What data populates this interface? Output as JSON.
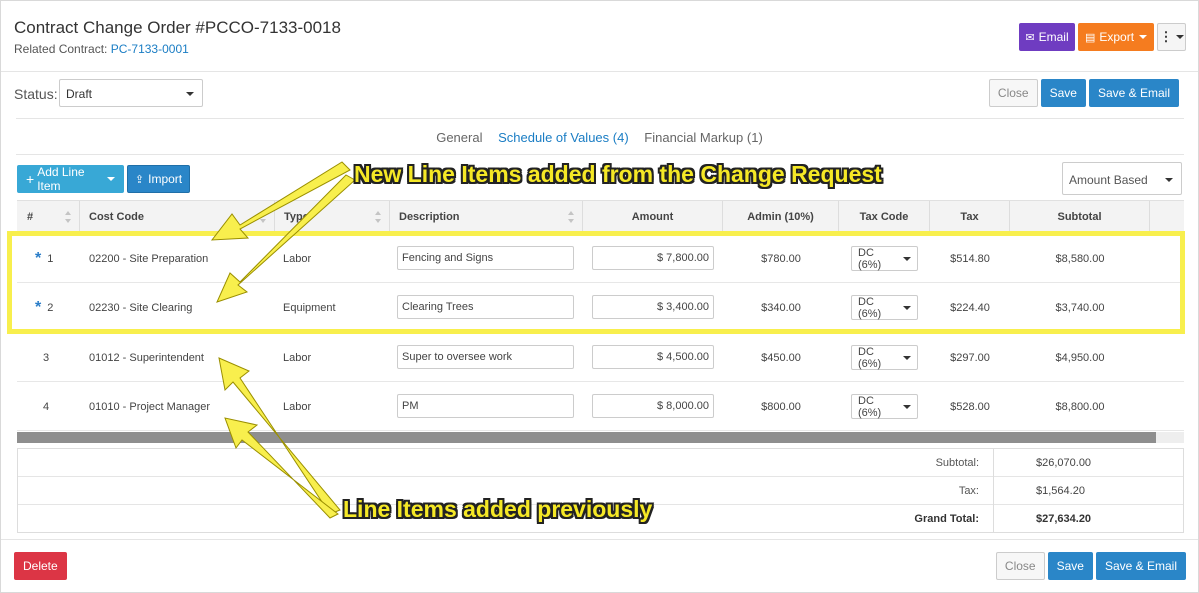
{
  "header": {
    "title": "Contract Change Order #PCCO-7133-0018",
    "related_label": "Related Contract:",
    "related_link": "PC-7133-0001",
    "email_label": "Email",
    "export_label": "Export"
  },
  "status": {
    "label": "Status:",
    "value": "Draft",
    "close_label": "Close",
    "save_label": "Save",
    "save_email_label": "Save & Email"
  },
  "tabs": [
    {
      "label": "General"
    },
    {
      "label": "Schedule of Values (4)"
    },
    {
      "label": "Financial Markup (1)"
    }
  ],
  "tools": {
    "add_label": "Add Line Item",
    "import_label": "Import",
    "amount_mode": "Amount Based"
  },
  "table": {
    "columns": [
      "#",
      "Cost Code",
      "Type",
      "Description",
      "Amount",
      "Admin (10%)",
      "Tax Code",
      "Tax",
      "Subtotal"
    ],
    "rows": [
      {
        "num": "1",
        "new": true,
        "cost_code": "02200 - Site Preparation",
        "type": "Labor",
        "description": "Fencing and Signs",
        "amount": "$ 7,800.00",
        "admin": "$780.00",
        "tax_code": "DC (6%)",
        "tax": "$514.80",
        "subtotal": "$8,580.00"
      },
      {
        "num": "2",
        "new": true,
        "cost_code": "02230 - Site Clearing",
        "type": "Equipment",
        "description": "Clearing Trees",
        "amount": "$ 3,400.00",
        "admin": "$340.00",
        "tax_code": "DC (6%)",
        "tax": "$224.40",
        "subtotal": "$3,740.00"
      },
      {
        "num": "3",
        "new": false,
        "cost_code": "01012 - Superintendent",
        "type": "Labor",
        "description": "Super to oversee work",
        "amount": "$ 4,500.00",
        "admin": "$450.00",
        "tax_code": "DC (6%)",
        "tax": "$297.00",
        "subtotal": "$4,950.00"
      },
      {
        "num": "4",
        "new": false,
        "cost_code": "01010 - Project Manager",
        "type": "Labor",
        "description": "PM",
        "amount": "$ 8,000.00",
        "admin": "$800.00",
        "tax_code": "DC (6%)",
        "tax": "$528.00",
        "subtotal": "$8,800.00"
      }
    ]
  },
  "totals": {
    "subtotal_label": "Subtotal:",
    "subtotal": "$26,070.00",
    "tax_label": "Tax:",
    "tax": "$1,564.20",
    "grand_label": "Grand Total:",
    "grand": "$27,634.20"
  },
  "footer": {
    "delete_label": "Delete",
    "close_label": "Close",
    "save_label": "Save",
    "save_email_label": "Save & Email"
  },
  "annotations": {
    "new_items": "New Line Items added from the Change Request",
    "previous_items": "Line Items added previously"
  },
  "colors": {
    "email": "#6f3cc1",
    "export": "#f57c1f",
    "primary": "#2a86c8",
    "danger": "#dc3545",
    "highlight": "#f8ef4d"
  }
}
